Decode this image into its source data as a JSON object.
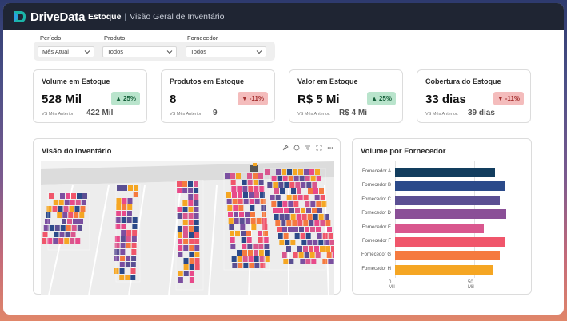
{
  "app": {
    "logo_text": "DriveData",
    "breadcrumb_main": "Estoque",
    "breadcrumb_sep": "|",
    "breadcrumb_sub": "Visão Geral de Inventário"
  },
  "filters": {
    "period_label": "Período",
    "period_value": "Mês Atual",
    "product_label": "Produto",
    "product_value": "Todos",
    "supplier_label": "Fornecedor",
    "supplier_value": "Todos"
  },
  "kpis": [
    {
      "title": "Volume em Estoque",
      "value": "528 Mil",
      "delta": "25%",
      "direction": "up",
      "vs_label": "VS Mês Anterior:",
      "prev": "422 Mil"
    },
    {
      "title": "Produtos em Estoque",
      "value": "8",
      "delta": "-11%",
      "direction": "down",
      "vs_label": "VS Mês Anterior:",
      "prev": "9"
    },
    {
      "title": "Valor em Estoque",
      "value": "R$ 5 Mi",
      "delta": "25%",
      "direction": "up",
      "vs_label": "VS Mês Anterior:",
      "prev": "R$ 4 Mi"
    },
    {
      "title": "Cobertura do Estoque",
      "value": "33 dias",
      "delta": "-11%",
      "direction": "down",
      "vs_label": "VS Mês Anterior:",
      "prev": "39 dias"
    }
  ],
  "inventory_panel": {
    "title": "Visão do Inventário"
  },
  "supplier_panel": {
    "title": "Volume por Fornecedor"
  },
  "chart_data": {
    "type": "bar",
    "orientation": "horizontal",
    "title": "Volume por Fornecedor",
    "categories": [
      "Fornecedor A",
      "Fornecedor B",
      "Fornecedor C",
      "Fornecedor D",
      "Fornecedor E",
      "Fornecedor F",
      "Fornecedor G",
      "Fornecedor H"
    ],
    "values": [
      63,
      69,
      66,
      70,
      56,
      69,
      66,
      62
    ],
    "colors": [
      "#123d5e",
      "#2b4a8a",
      "#5b4f93",
      "#8a4f97",
      "#d9578e",
      "#f0566b",
      "#f57a3f",
      "#f5a623"
    ],
    "x_ticks": [
      "0 Mil",
      "50 Mil"
    ],
    "xlim": [
      0,
      100
    ],
    "grid": true
  },
  "colors": {
    "topbar": "#1f2533",
    "up_badge": "#b9e4cc",
    "down_badge": "#f4bcbc"
  }
}
